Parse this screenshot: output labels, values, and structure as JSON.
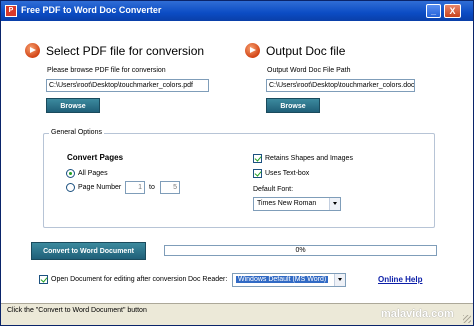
{
  "window": {
    "title": "Free PDF to Word Doc Converter",
    "icon": "pdf-app-icon",
    "minimize_icon": "_",
    "close_icon": "X"
  },
  "select_pdf": {
    "heading": "Select PDF file for conversion",
    "hint": "Please browse PDF file for conversion",
    "path": "C:\\Users\\root\\Desktop\\touchmarker_colors.pdf",
    "browse_label": "Browse"
  },
  "output_doc": {
    "heading": "Output Doc file",
    "hint": "Output Word Doc File Path",
    "path": "C:\\Users\\root\\Desktop\\touchmarker_colors.doc",
    "browse_label": "Browse"
  },
  "general_options": {
    "legend": "General Options",
    "convert_pages_label": "Convert Pages",
    "all_pages_label": "All Pages",
    "all_pages_selected": true,
    "page_number_label": "Page Number",
    "page_from": "1",
    "to_label": "to",
    "page_to": "5",
    "retain_shapes_label": "Retains Shapes and Images",
    "retain_shapes_checked": true,
    "uses_textbox_label": "Uses Text-box",
    "uses_textbox_checked": true,
    "default_font_label": "Default Font:",
    "default_font_value": "Times New Roman"
  },
  "convert": {
    "button_label": "Convert to Word Document",
    "progress_text": "0%",
    "progress_fraction": 0
  },
  "bottom": {
    "open_doc_label": "Open Document for editing after conversion",
    "open_doc_checked": true,
    "doc_reader_label": "Doc Reader:",
    "doc_reader_value": "Windows Default (MS Word)",
    "online_help_label": "Online Help"
  },
  "status": {
    "text": "Click the \"Convert to Word Document\" button",
    "watermark": "malavida.com"
  },
  "colors": {
    "titlebar": "#0b4cc4",
    "button": "#1f5f78",
    "accent_arrow": "#d24415",
    "link": "#0b1ea8"
  }
}
